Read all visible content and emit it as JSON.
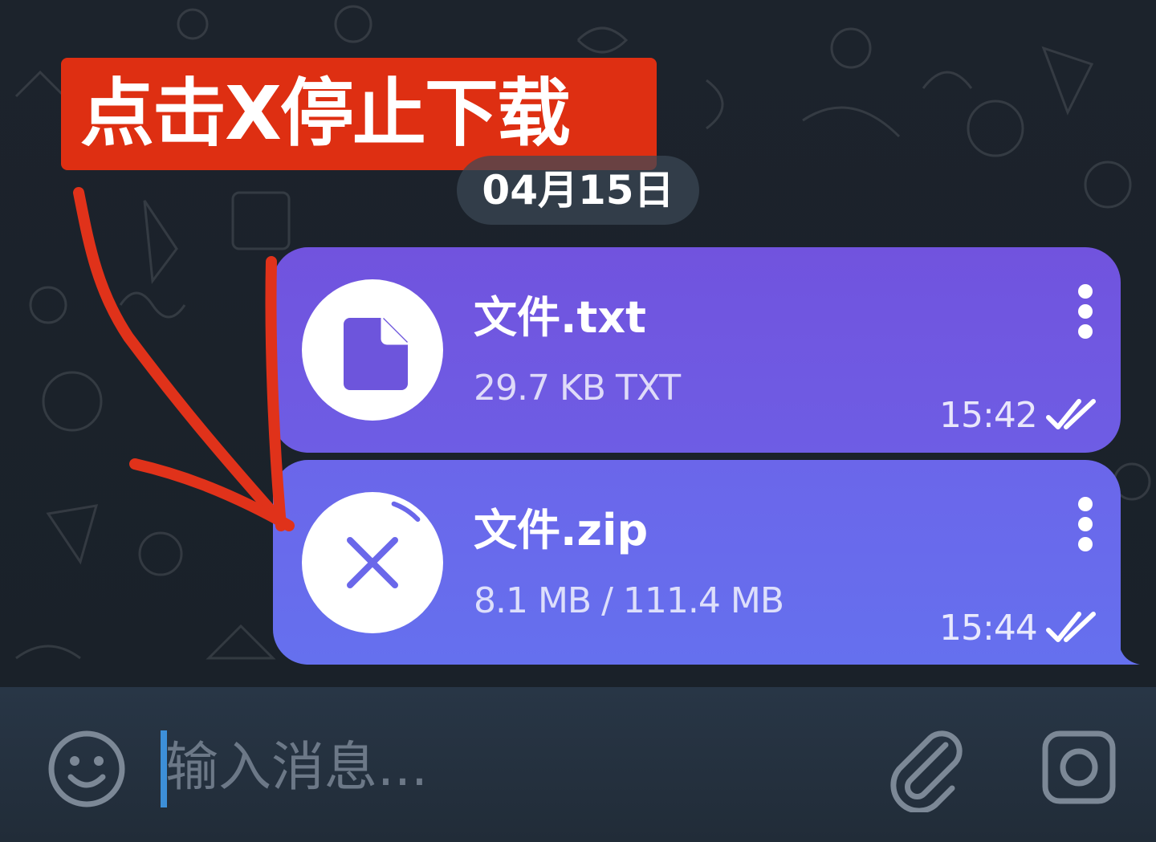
{
  "annotation": {
    "text": "点击X停止下载",
    "color": "#de2f12"
  },
  "chat": {
    "date_separator": "04月15日",
    "messages": [
      {
        "file_name": "文件.txt",
        "meta": "29.7 KB TXT",
        "time": "15:42",
        "icon": "document-icon",
        "status": "read",
        "bubble_color": "#7153de"
      },
      {
        "file_name": "文件.zip",
        "meta": "8.1 MB / 111.4 MB",
        "time": "15:44",
        "icon": "cancel-download-icon",
        "status": "read",
        "download_progress": 0.073,
        "bubble_color": "#6b66ea"
      }
    ]
  },
  "input_bar": {
    "placeholder": "输入消息...",
    "value": "",
    "icons": [
      "emoji-icon",
      "attach-icon",
      "camera-icon"
    ]
  },
  "colors": {
    "background": "#1b222b",
    "input_bar": "#283646",
    "caret": "#3d8fd8",
    "icon_gray": "#7c8896",
    "arrow": "#e0321a"
  }
}
